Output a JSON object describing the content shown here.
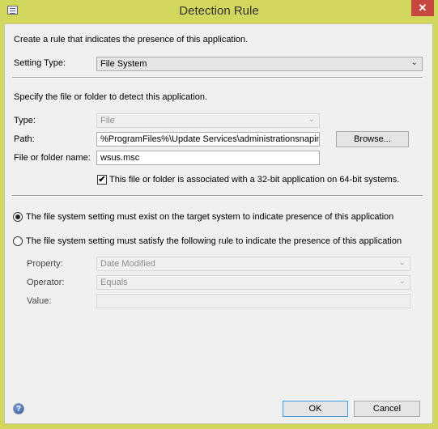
{
  "window": {
    "title": "Detection Rule",
    "close_glyph": "✕"
  },
  "intro": "Create a rule that indicates the presence of this application.",
  "setting_type": {
    "label": "Setting Type:",
    "value": "File System"
  },
  "file_section": {
    "instruction": "Specify the file or folder to detect this application.",
    "type": {
      "label": "Type:",
      "value": "File"
    },
    "path": {
      "label": "Path:",
      "value": "%ProgramFiles%\\Update Services\\administrationsnapin"
    },
    "browse_label": "Browse...",
    "name": {
      "label": "File or folder name:",
      "value": "wsus.msc"
    },
    "checkbox": {
      "label": "This file or folder is associated with a 32-bit application on 64-bit systems.",
      "checked": true,
      "glyph": "✔"
    }
  },
  "rule": {
    "option_exist": {
      "label": "The file system setting must exist on the target system to indicate presence of this application",
      "selected": true
    },
    "option_satisfy": {
      "label": "The file system setting must satisfy the following rule to indicate the presence of this application",
      "selected": false
    },
    "property": {
      "label": "Property:",
      "value": "Date Modified"
    },
    "operator": {
      "label": "Operator:",
      "value": "Equals"
    },
    "value": {
      "label": "Value:",
      "value": ""
    }
  },
  "footer": {
    "help_glyph": "?",
    "ok_label": "OK",
    "cancel_label": "Cancel"
  },
  "chev": "⌄"
}
